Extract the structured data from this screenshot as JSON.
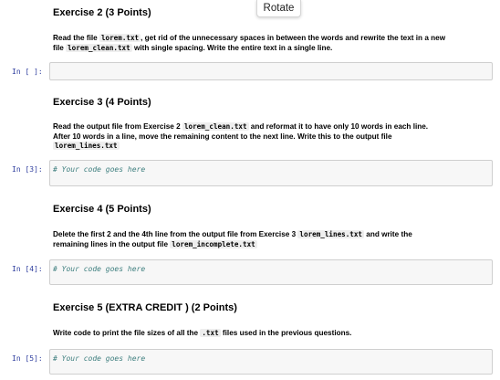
{
  "overlay": {
    "rotate_label": "Rotate"
  },
  "exercise2": {
    "heading": "Exercise 2 (3 Points)",
    "line1_a": "Read the file ",
    "line1_code1": "lorem.txt",
    "line1_b": ", get rid of the unnecessary spaces in between the words and rewrite the text in a new",
    "line2_a": "file ",
    "line2_code": "lorem_clean.txt",
    "line2_b": " with single spacing. Write the entire text in a single line.",
    "prompt": "In [ ]:",
    "cell_code": ""
  },
  "exercise3": {
    "heading": "Exercise 3 (4 Points)",
    "line1_a": "Read the output file from Exercise 2 ",
    "line1_code": "lorem_clean.txt",
    "line1_b": " and reformat it to have only 10 words in each line.",
    "line2": "After 10 words in a line, move the remaining content to the next line. Write this to the output file",
    "line3_code": "lorem_lines.txt",
    "prompt": "In [3]:",
    "cell_code": "# Your code goes here"
  },
  "exercise4": {
    "heading": "Exercise 4 (5 Points)",
    "line1_a": "Delete the first 2 and the 4th line from the output file from Exercise 3 ",
    "line1_code": "lorem_lines.txt",
    "line1_b": " and write the",
    "line2_a": "remaining lines in the output file ",
    "line2_code": "lorem_incomplete.txt",
    "prompt": "In [4]:",
    "cell_code": "# Your code goes here"
  },
  "exercise5": {
    "heading": "Exercise 5 (EXTRA CREDIT ) (2 Points)",
    "line1_a": "Write code to print the file sizes of all the ",
    "line1_code": ".txt",
    "line1_b": " files used in the previous questions.",
    "prompt": "In [5]:",
    "cell_code": "# Your code goes here"
  }
}
